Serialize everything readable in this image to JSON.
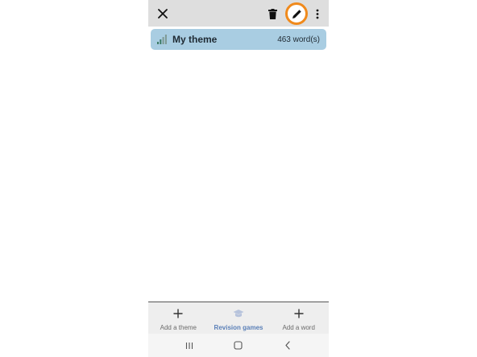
{
  "toolbar": {
    "close_icon": "close-icon",
    "delete_icon": "trash-icon",
    "edit_icon": "pencil-icon",
    "more_icon": "more-vertical-icon",
    "highlight_color": "#f08a1c",
    "background_color": "#dedede"
  },
  "theme": {
    "name": "My theme",
    "count": "463 word(s)",
    "icon": "signal-bars-icon",
    "background_color": "#a9cde2"
  },
  "bottom_nav": {
    "items": [
      {
        "label": "Add a theme",
        "icon": "plus-icon",
        "active": false
      },
      {
        "label": "Revision games",
        "icon": "graduation-cap-icon",
        "active": true
      },
      {
        "label": "Add a word",
        "icon": "plus-icon",
        "active": false
      }
    ],
    "active_color": "#5b80b8"
  },
  "system_nav": {
    "recents_icon": "recents-icon",
    "home_icon": "home-icon",
    "back_icon": "back-icon"
  }
}
